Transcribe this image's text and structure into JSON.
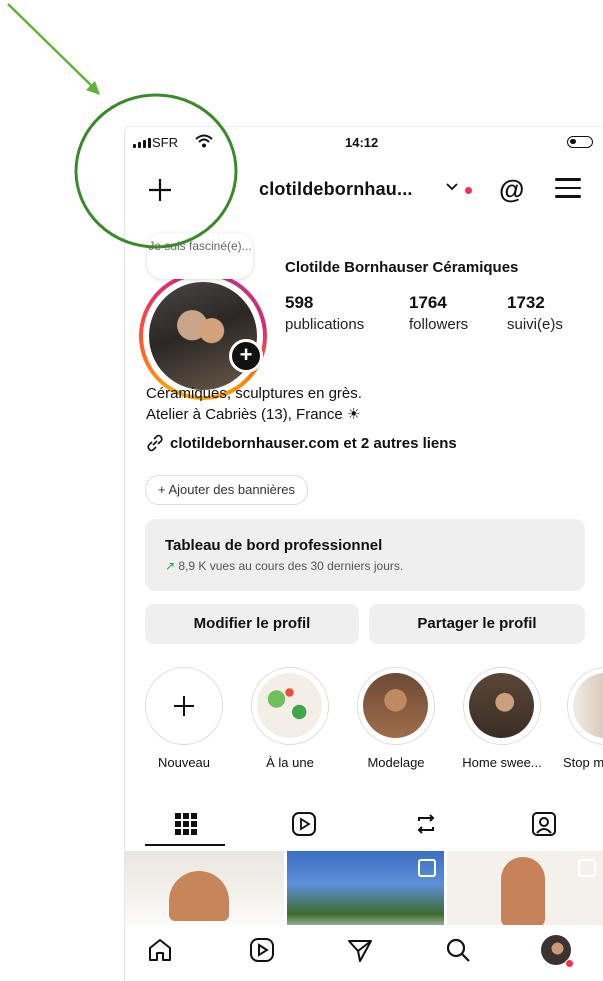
{
  "status": {
    "carrier": "SFR",
    "time": "14:12"
  },
  "header": {
    "username": "clotildebornhau...",
    "new_post_icon": "plus-icon",
    "threads_icon": "threads-icon",
    "menu_icon": "hamburger-menu-icon"
  },
  "profile": {
    "note": "Je suis fasciné(e)...",
    "full_name": "Clotilde Bornhauser Céramiques",
    "stats": [
      {
        "number": "598",
        "label": "publications"
      },
      {
        "number": "1764",
        "label": "followers"
      },
      {
        "number": "1732",
        "label": "suivi(e)s"
      }
    ],
    "bio_line1": "Céramiques, sculptures en grès.",
    "bio_line2": "Atelier à Cabriès (13), France ☀",
    "link_text": "clotildebornhauser.com et 2 autres liens",
    "add_banners": "+ Ajouter des bannières"
  },
  "dashboard": {
    "title": "Tableau de bord professionnel",
    "trend_arrow": "↗",
    "subtitle": "8,9 K vues au cours des 30 derniers jours."
  },
  "buttons": {
    "edit": "Modifier le profil",
    "share": "Partager le profil"
  },
  "highlights": [
    {
      "label": "Nouveau"
    },
    {
      "label": "À la une"
    },
    {
      "label": "Modelage"
    },
    {
      "label": "Home swee..."
    },
    {
      "label": "Stop m"
    }
  ],
  "tabs": [
    "grid-icon",
    "reels-icon",
    "reposts-icon",
    "tagged-icon"
  ],
  "nav": [
    "home-icon",
    "reels-icon",
    "direct-icon",
    "search-icon",
    "profile-avatar"
  ],
  "colors": {
    "annotation_green": "#3a8a2a",
    "arrow_green": "#5fb33a",
    "notification_red": "#ff2d55",
    "trend_green": "#1aa04d"
  }
}
